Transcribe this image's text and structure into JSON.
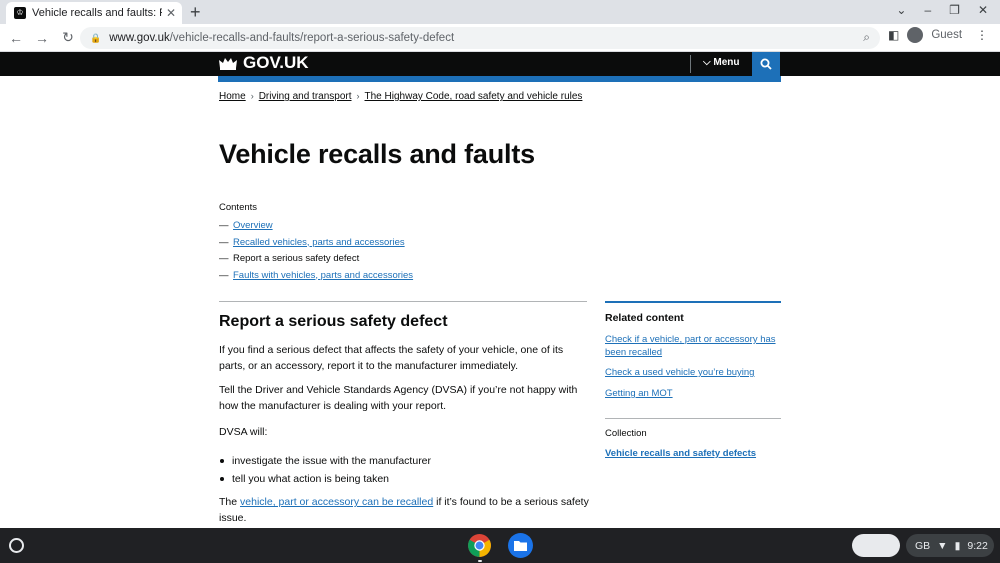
{
  "browser": {
    "tab_title": "Vehicle recalls and faults: Report",
    "new_tab": "+",
    "url_domain": "www.gov.uk",
    "url_path": "/vehicle-recalls-and-faults/report-a-serious-safety-defect",
    "profile_label": "Guest"
  },
  "header": {
    "logo_text": "GOV.UK",
    "menu_label": "Menu"
  },
  "breadcrumb": [
    "Home",
    "Driving and transport",
    "The Highway Code, road safety and vehicle rules"
  ],
  "page_title": "Vehicle recalls and faults",
  "contents": {
    "heading": "Contents",
    "items": [
      {
        "label": "Overview",
        "current": false
      },
      {
        "label": "Recalled vehicles, parts and accessories",
        "current": false
      },
      {
        "label": "Report a serious safety defect",
        "current": true
      },
      {
        "label": "Faults with vehicles, parts and accessories",
        "current": false
      }
    ]
  },
  "section": {
    "heading": "Report a serious safety defect",
    "para1": "If you find a serious defect that affects the safety of your vehicle, one of its parts, or an accessory, report it to the manufacturer immediately.",
    "para2": "Tell the Driver and Vehicle Standards Agency (DVSA) if you’re not happy with how the manufacturer is dealing with your report.",
    "para3": "DVSA will:",
    "bullets": [
      "investigate the issue with the manufacturer",
      "tell you what action is being taken"
    ],
    "para4_pre": "The ",
    "para4_link": "vehicle, part or accessory can be recalled",
    "para4_post": " if it’s found to be a serious safety issue."
  },
  "related": {
    "heading": "Related content",
    "links": [
      "Check if a vehicle, part or accessory has been recalled",
      "Check a used vehicle you’re buying",
      "Getting an MOT"
    ],
    "collection_heading": "Collection",
    "collection_link": "Vehicle recalls and safety defects"
  },
  "shelf": {
    "locale": "GB",
    "time": "9:22"
  }
}
